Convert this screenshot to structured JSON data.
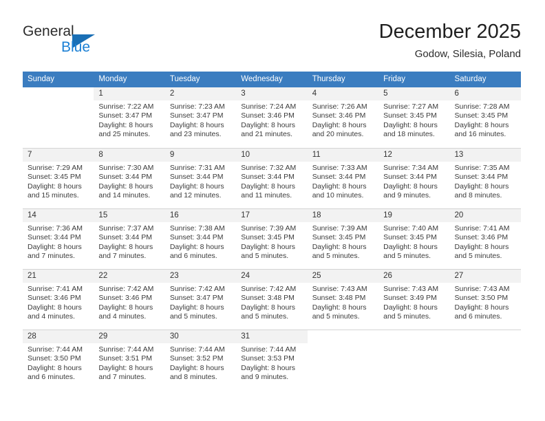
{
  "brand": {
    "name_part1": "General",
    "name_part2": "Blue",
    "triangle_color": "#1a6fb5",
    "blue_color": "#1a7fd4"
  },
  "header": {
    "title": "December 2025",
    "subtitle": "Godow, Silesia, Poland"
  },
  "calendar": {
    "header_bg": "#3b7dc0",
    "daynum_bg": "#f2f2f2",
    "weekdays": [
      "Sunday",
      "Monday",
      "Tuesday",
      "Wednesday",
      "Thursday",
      "Friday",
      "Saturday"
    ],
    "weeks": [
      [
        {
          "day": ""
        },
        {
          "day": "1",
          "sunrise": "Sunrise: 7:22 AM",
          "sunset": "Sunset: 3:47 PM",
          "daylight_1": "Daylight: 8 hours",
          "daylight_2": "and 25 minutes."
        },
        {
          "day": "2",
          "sunrise": "Sunrise: 7:23 AM",
          "sunset": "Sunset: 3:47 PM",
          "daylight_1": "Daylight: 8 hours",
          "daylight_2": "and 23 minutes."
        },
        {
          "day": "3",
          "sunrise": "Sunrise: 7:24 AM",
          "sunset": "Sunset: 3:46 PM",
          "daylight_1": "Daylight: 8 hours",
          "daylight_2": "and 21 minutes."
        },
        {
          "day": "4",
          "sunrise": "Sunrise: 7:26 AM",
          "sunset": "Sunset: 3:46 PM",
          "daylight_1": "Daylight: 8 hours",
          "daylight_2": "and 20 minutes."
        },
        {
          "day": "5",
          "sunrise": "Sunrise: 7:27 AM",
          "sunset": "Sunset: 3:45 PM",
          "daylight_1": "Daylight: 8 hours",
          "daylight_2": "and 18 minutes."
        },
        {
          "day": "6",
          "sunrise": "Sunrise: 7:28 AM",
          "sunset": "Sunset: 3:45 PM",
          "daylight_1": "Daylight: 8 hours",
          "daylight_2": "and 16 minutes."
        }
      ],
      [
        {
          "day": "7",
          "sunrise": "Sunrise: 7:29 AM",
          "sunset": "Sunset: 3:45 PM",
          "daylight_1": "Daylight: 8 hours",
          "daylight_2": "and 15 minutes."
        },
        {
          "day": "8",
          "sunrise": "Sunrise: 7:30 AM",
          "sunset": "Sunset: 3:44 PM",
          "daylight_1": "Daylight: 8 hours",
          "daylight_2": "and 14 minutes."
        },
        {
          "day": "9",
          "sunrise": "Sunrise: 7:31 AM",
          "sunset": "Sunset: 3:44 PM",
          "daylight_1": "Daylight: 8 hours",
          "daylight_2": "and 12 minutes."
        },
        {
          "day": "10",
          "sunrise": "Sunrise: 7:32 AM",
          "sunset": "Sunset: 3:44 PM",
          "daylight_1": "Daylight: 8 hours",
          "daylight_2": "and 11 minutes."
        },
        {
          "day": "11",
          "sunrise": "Sunrise: 7:33 AM",
          "sunset": "Sunset: 3:44 PM",
          "daylight_1": "Daylight: 8 hours",
          "daylight_2": "and 10 minutes."
        },
        {
          "day": "12",
          "sunrise": "Sunrise: 7:34 AM",
          "sunset": "Sunset: 3:44 PM",
          "daylight_1": "Daylight: 8 hours",
          "daylight_2": "and 9 minutes."
        },
        {
          "day": "13",
          "sunrise": "Sunrise: 7:35 AM",
          "sunset": "Sunset: 3:44 PM",
          "daylight_1": "Daylight: 8 hours",
          "daylight_2": "and 8 minutes."
        }
      ],
      [
        {
          "day": "14",
          "sunrise": "Sunrise: 7:36 AM",
          "sunset": "Sunset: 3:44 PM",
          "daylight_1": "Daylight: 8 hours",
          "daylight_2": "and 7 minutes."
        },
        {
          "day": "15",
          "sunrise": "Sunrise: 7:37 AM",
          "sunset": "Sunset: 3:44 PM",
          "daylight_1": "Daylight: 8 hours",
          "daylight_2": "and 7 minutes."
        },
        {
          "day": "16",
          "sunrise": "Sunrise: 7:38 AM",
          "sunset": "Sunset: 3:44 PM",
          "daylight_1": "Daylight: 8 hours",
          "daylight_2": "and 6 minutes."
        },
        {
          "day": "17",
          "sunrise": "Sunrise: 7:39 AM",
          "sunset": "Sunset: 3:45 PM",
          "daylight_1": "Daylight: 8 hours",
          "daylight_2": "and 5 minutes."
        },
        {
          "day": "18",
          "sunrise": "Sunrise: 7:39 AM",
          "sunset": "Sunset: 3:45 PM",
          "daylight_1": "Daylight: 8 hours",
          "daylight_2": "and 5 minutes."
        },
        {
          "day": "19",
          "sunrise": "Sunrise: 7:40 AM",
          "sunset": "Sunset: 3:45 PM",
          "daylight_1": "Daylight: 8 hours",
          "daylight_2": "and 5 minutes."
        },
        {
          "day": "20",
          "sunrise": "Sunrise: 7:41 AM",
          "sunset": "Sunset: 3:46 PM",
          "daylight_1": "Daylight: 8 hours",
          "daylight_2": "and 5 minutes."
        }
      ],
      [
        {
          "day": "21",
          "sunrise": "Sunrise: 7:41 AM",
          "sunset": "Sunset: 3:46 PM",
          "daylight_1": "Daylight: 8 hours",
          "daylight_2": "and 4 minutes."
        },
        {
          "day": "22",
          "sunrise": "Sunrise: 7:42 AM",
          "sunset": "Sunset: 3:46 PM",
          "daylight_1": "Daylight: 8 hours",
          "daylight_2": "and 4 minutes."
        },
        {
          "day": "23",
          "sunrise": "Sunrise: 7:42 AM",
          "sunset": "Sunset: 3:47 PM",
          "daylight_1": "Daylight: 8 hours",
          "daylight_2": "and 5 minutes."
        },
        {
          "day": "24",
          "sunrise": "Sunrise: 7:42 AM",
          "sunset": "Sunset: 3:48 PM",
          "daylight_1": "Daylight: 8 hours",
          "daylight_2": "and 5 minutes."
        },
        {
          "day": "25",
          "sunrise": "Sunrise: 7:43 AM",
          "sunset": "Sunset: 3:48 PM",
          "daylight_1": "Daylight: 8 hours",
          "daylight_2": "and 5 minutes."
        },
        {
          "day": "26",
          "sunrise": "Sunrise: 7:43 AM",
          "sunset": "Sunset: 3:49 PM",
          "daylight_1": "Daylight: 8 hours",
          "daylight_2": "and 5 minutes."
        },
        {
          "day": "27",
          "sunrise": "Sunrise: 7:43 AM",
          "sunset": "Sunset: 3:50 PM",
          "daylight_1": "Daylight: 8 hours",
          "daylight_2": "and 6 minutes."
        }
      ],
      [
        {
          "day": "28",
          "sunrise": "Sunrise: 7:44 AM",
          "sunset": "Sunset: 3:50 PM",
          "daylight_1": "Daylight: 8 hours",
          "daylight_2": "and 6 minutes."
        },
        {
          "day": "29",
          "sunrise": "Sunrise: 7:44 AM",
          "sunset": "Sunset: 3:51 PM",
          "daylight_1": "Daylight: 8 hours",
          "daylight_2": "and 7 minutes."
        },
        {
          "day": "30",
          "sunrise": "Sunrise: 7:44 AM",
          "sunset": "Sunset: 3:52 PM",
          "daylight_1": "Daylight: 8 hours",
          "daylight_2": "and 8 minutes."
        },
        {
          "day": "31",
          "sunrise": "Sunrise: 7:44 AM",
          "sunset": "Sunset: 3:53 PM",
          "daylight_1": "Daylight: 8 hours",
          "daylight_2": "and 9 minutes."
        },
        {
          "day": ""
        },
        {
          "day": ""
        },
        {
          "day": ""
        }
      ]
    ]
  }
}
